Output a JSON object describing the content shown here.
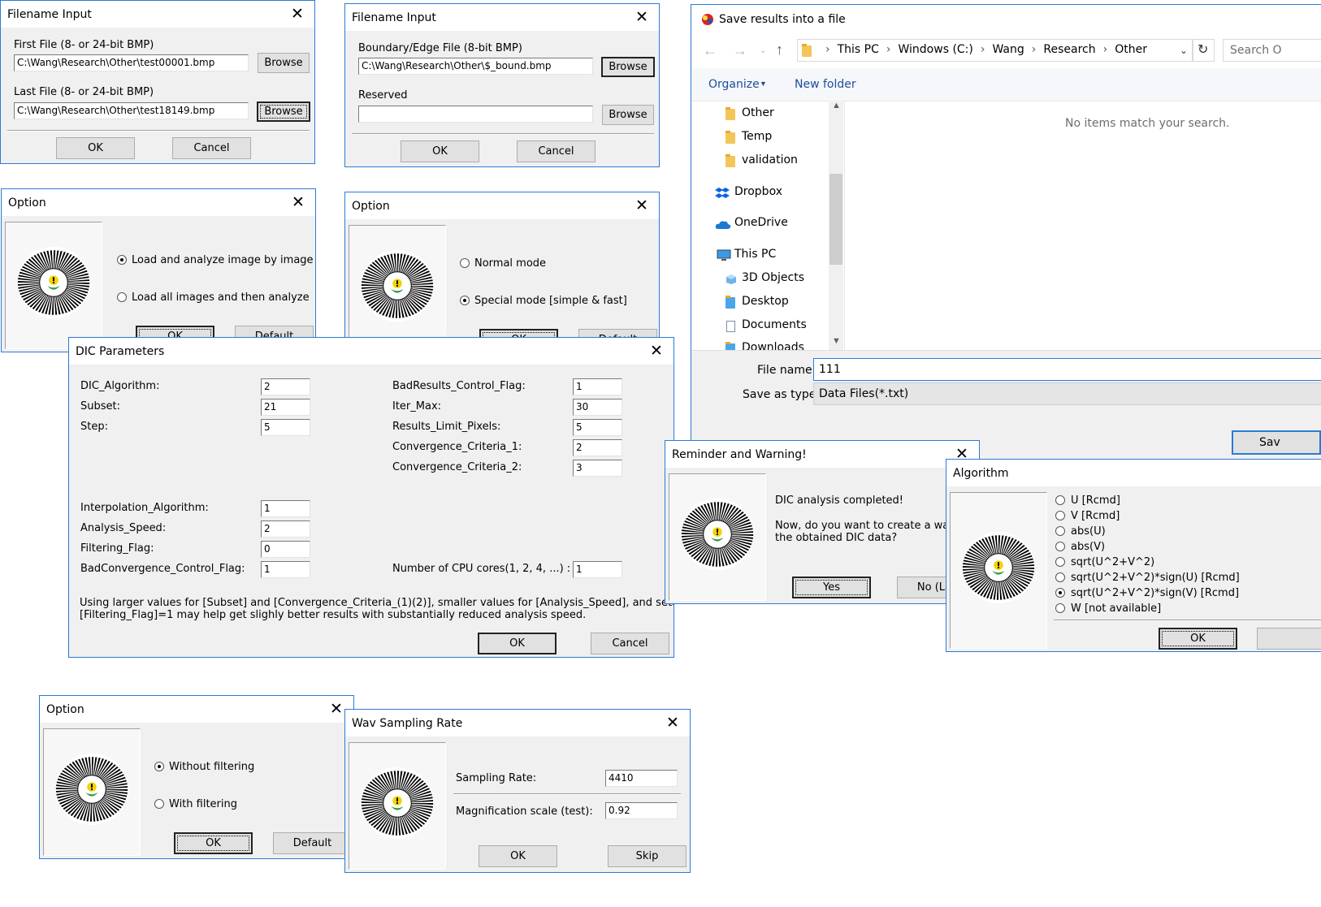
{
  "filename_input_1": {
    "title": "Filename Input",
    "first_label": "First File (8- or 24-bit BMP)",
    "first_value": "C:\\Wang\\Research\\Other\\test00001.bmp",
    "browse1": "Browse",
    "last_label": "Last File (8- or 24-bit BMP)",
    "last_value": "C:\\Wang\\Research\\Other\\test18149.bmp",
    "browse2": "Browse",
    "ok": "OK",
    "cancel": "Cancel"
  },
  "filename_input_2": {
    "title": "Filename Input",
    "boundary_label": "Boundary/Edge File (8-bit BMP)",
    "boundary_value": "C:\\Wang\\Research\\Other\\$_bound.bmp",
    "browse1": "Browse",
    "reserved_label": "Reserved",
    "reserved_value": "",
    "browse2": "Browse",
    "ok": "OK",
    "cancel": "Cancel"
  },
  "option_1": {
    "title": "Option",
    "radio1": "Load and analyze image by image",
    "radio2": "Load all images and then analyze",
    "ok": "OK",
    "default": "Default"
  },
  "option_2": {
    "title": "Option",
    "radio1": "Normal mode",
    "radio2": "Special mode [simple & fast]",
    "ok": "OK",
    "default": "Default"
  },
  "dic": {
    "title": "DIC Parameters",
    "left_params": [
      {
        "label": "DIC_Algorithm:",
        "value": "2"
      },
      {
        "label": "Subset:",
        "value": "21"
      },
      {
        "label": "Step:",
        "value": "5"
      },
      {
        "label": "Interpolation_Algorithm:",
        "value": "1"
      },
      {
        "label": "Analysis_Speed:",
        "value": "2"
      },
      {
        "label": "Filtering_Flag:",
        "value": "0"
      },
      {
        "label": "BadConvergence_Control_Flag:",
        "value": "1"
      }
    ],
    "right_params": [
      {
        "label": "BadResults_Control_Flag:",
        "value": "1"
      },
      {
        "label": "Iter_Max:",
        "value": "30"
      },
      {
        "label": "Results_Limit_Pixels:",
        "value": "5"
      },
      {
        "label": "Convergence_Criteria_1:",
        "value": "2"
      },
      {
        "label": "Convergence_Criteria_2:",
        "value": "3"
      },
      {
        "label": "Number of CPU cores(1, 2, 4, ...) :",
        "value": "1"
      }
    ],
    "note_line1": "Using larger values for [Subset] and [Convergence_Criteria_(1)(2)], smaller values for [Analysis_Speed], and setting",
    "note_line2": "[Filtering_Flag]=1 may help get slighly better results with substantially reduced analysis speed.",
    "ok": "OK",
    "cancel": "Cancel"
  },
  "option_3": {
    "title": "Option",
    "radio1": "Without filtering",
    "radio2": "With filtering",
    "ok": "OK",
    "default": "Default"
  },
  "wav": {
    "title": "Wav Sampling Rate",
    "rate_label": "Sampling Rate:",
    "rate_value": "4410",
    "mag_label": "Magnification scale (test):",
    "mag_value": "0.92",
    "ok": "OK",
    "skip": "Skip"
  },
  "save": {
    "title": "Save results into a file",
    "path": [
      "This PC",
      "Windows (C:)",
      "Wang",
      "Research",
      "Other"
    ],
    "search_placeholder": "Search O",
    "organize": "Organize",
    "new_folder": "New folder",
    "nav": [
      "Other",
      "Temp",
      "validation",
      "Dropbox",
      "OneDrive",
      "This PC",
      "3D Objects",
      "Desktop",
      "Documents",
      "Downloads"
    ],
    "empty_message": "No items match your search.",
    "filename_label": "File name:",
    "filename_value": "111",
    "type_label": "Save as type:",
    "type_value": "Data Files(*.txt)",
    "save_button": "Sav"
  },
  "reminder": {
    "title": "Reminder and Warning!",
    "line1": "DIC analysis completed!",
    "line2": "Now, do you want to create a wav file",
    "line3": "the obtained DIC data?",
    "yes": "Yes",
    "no": "No (Lat"
  },
  "algorithm": {
    "title": "Algorithm",
    "options": [
      {
        "label": "U [Rcmd]",
        "selected": false
      },
      {
        "label": "V [Rcmd]",
        "selected": false
      },
      {
        "label": "abs(U)",
        "selected": false
      },
      {
        "label": "abs(V)",
        "selected": false
      },
      {
        "label": "sqrt(U^2+V^2)",
        "selected": false
      },
      {
        "label": "sqrt(U^2+V^2)*sign(U) [Rcmd]",
        "selected": false
      },
      {
        "label": "sqrt(U^2+V^2)*sign(V) [Rcmd]",
        "selected": true
      },
      {
        "label": "W [not available]",
        "selected": false
      }
    ],
    "ok": "OK"
  }
}
